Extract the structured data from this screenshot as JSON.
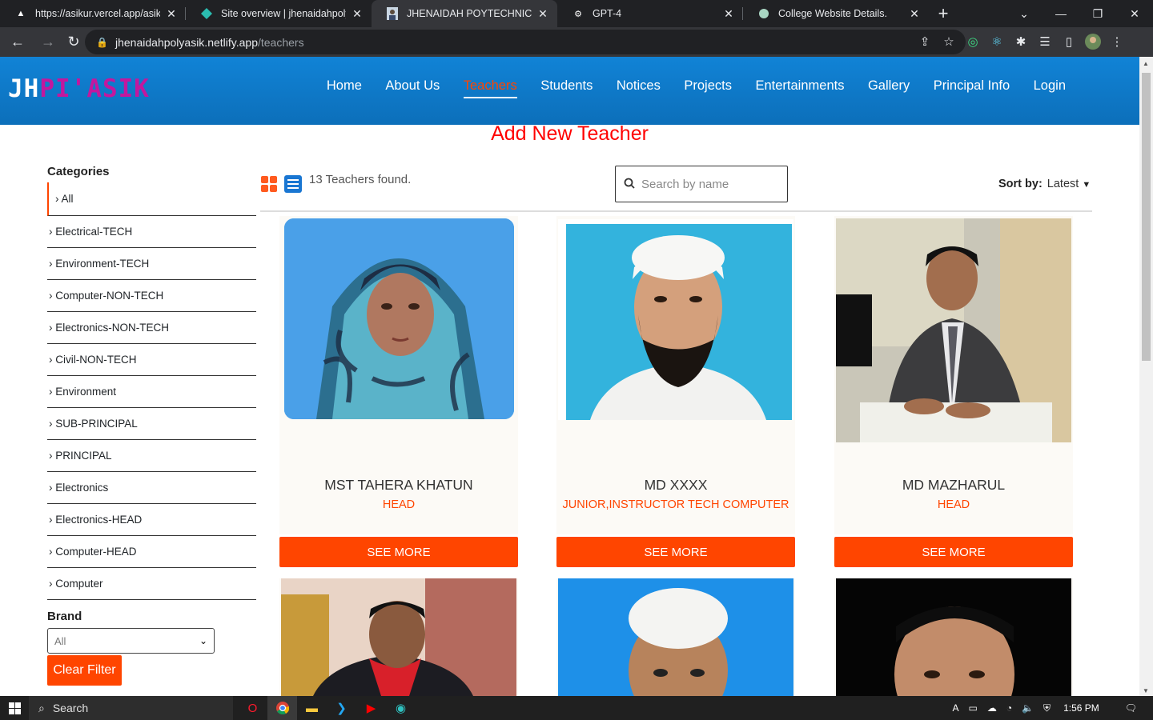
{
  "browser": {
    "tabs": [
      {
        "title": "https://asikur.vercel.app/asikur/...",
        "active": false
      },
      {
        "title": "Site overview | jhenaidahpolyasi",
        "active": false
      },
      {
        "title": "JHENAIDAH POYTECHNIC INST",
        "active": true
      },
      {
        "title": "GPT-4",
        "active": false
      },
      {
        "title": "College Website Details.",
        "active": false
      }
    ],
    "url_host": "jhenaidahpolyasik.netlify.app",
    "url_path": "/teachers"
  },
  "site": {
    "logo_part1": "JH",
    "logo_part2": "PI'ASIK",
    "nav": [
      "Home",
      "About Us",
      "Teachers",
      "Students",
      "Notices",
      "Projects",
      "Entertainments",
      "Gallery",
      "Principal Info",
      "Login"
    ],
    "active_nav": "Teachers",
    "page_title": "Add New Teacher"
  },
  "sidebar": {
    "heading": "Categories",
    "categories": [
      "› All",
      "› Electrical-TECH",
      "› Environment-TECH",
      "› Computer-NON-TECH",
      "› Electronics-NON-TECH",
      "› Civil-NON-TECH",
      "› Environment",
      "› SUB-PRINCIPAL",
      "› PRINCIPAL",
      "› Electronics",
      "› Electronics-HEAD",
      "› Computer-HEAD",
      "› Computer"
    ],
    "brand_label": "Brand",
    "brand_value": "All",
    "clear_filter": "Clear Filter"
  },
  "listing": {
    "found_text": "13 Teachers found.",
    "search_placeholder": "Search by name",
    "sort_label": "Sort by:",
    "sort_value": "Latest"
  },
  "teachers": [
    {
      "name": "MST TAHERA KHATUN",
      "role": "HEAD",
      "button": "SEE MORE"
    },
    {
      "name": "MD XXXX",
      "role": "JUNIOR,INSTRUCTOR TECH COMPUTER",
      "button": "SEE MORE"
    },
    {
      "name": "MD MAZHARUL",
      "role": "HEAD",
      "button": "SEE MORE"
    }
  ],
  "taskbar": {
    "search": "Search",
    "time": "1:56 PM"
  }
}
